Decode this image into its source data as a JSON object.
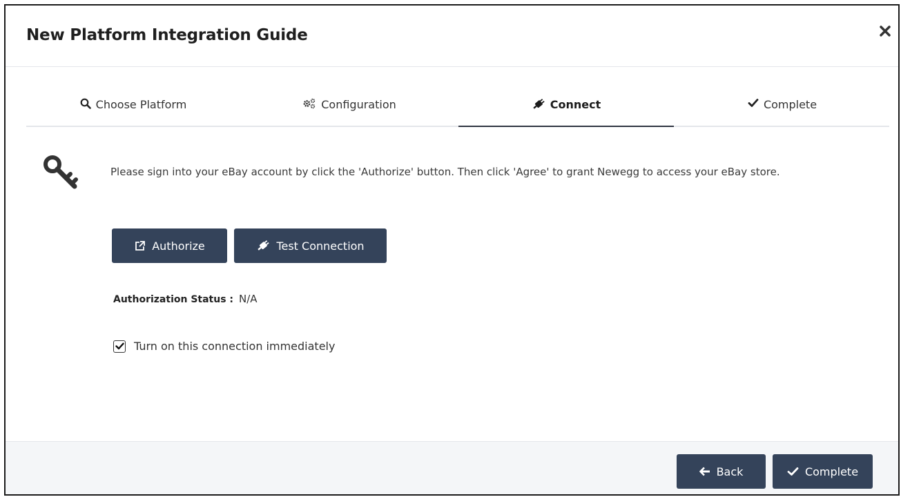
{
  "modal": {
    "title": "New Platform Integration Guide"
  },
  "tabs": [
    {
      "label": "Choose Platform",
      "icon": "search-icon",
      "active": false
    },
    {
      "label": "Configuration",
      "icon": "cogs-icon",
      "active": false
    },
    {
      "label": "Connect",
      "icon": "plug-icon",
      "active": true
    },
    {
      "label": "Complete",
      "icon": "check-icon",
      "active": false
    }
  ],
  "connect": {
    "icon": "key-icon",
    "instructions": "Please sign into your eBay account by click the 'Authorize' button. Then click 'Agree' to grant Newegg to access your eBay store.",
    "authorize_label": "Authorize",
    "test_connection_label": "Test Connection",
    "status_label": "Authorization Status :",
    "status_value": "N/A",
    "turn_on_label": "Turn on this connection immediately",
    "turn_on_checked": true
  },
  "footer": {
    "back_label": "Back",
    "complete_label": "Complete"
  },
  "colors": {
    "button_bg": "#34435a",
    "footer_bg": "#f4f6f8",
    "border": "#e3e6ea"
  }
}
